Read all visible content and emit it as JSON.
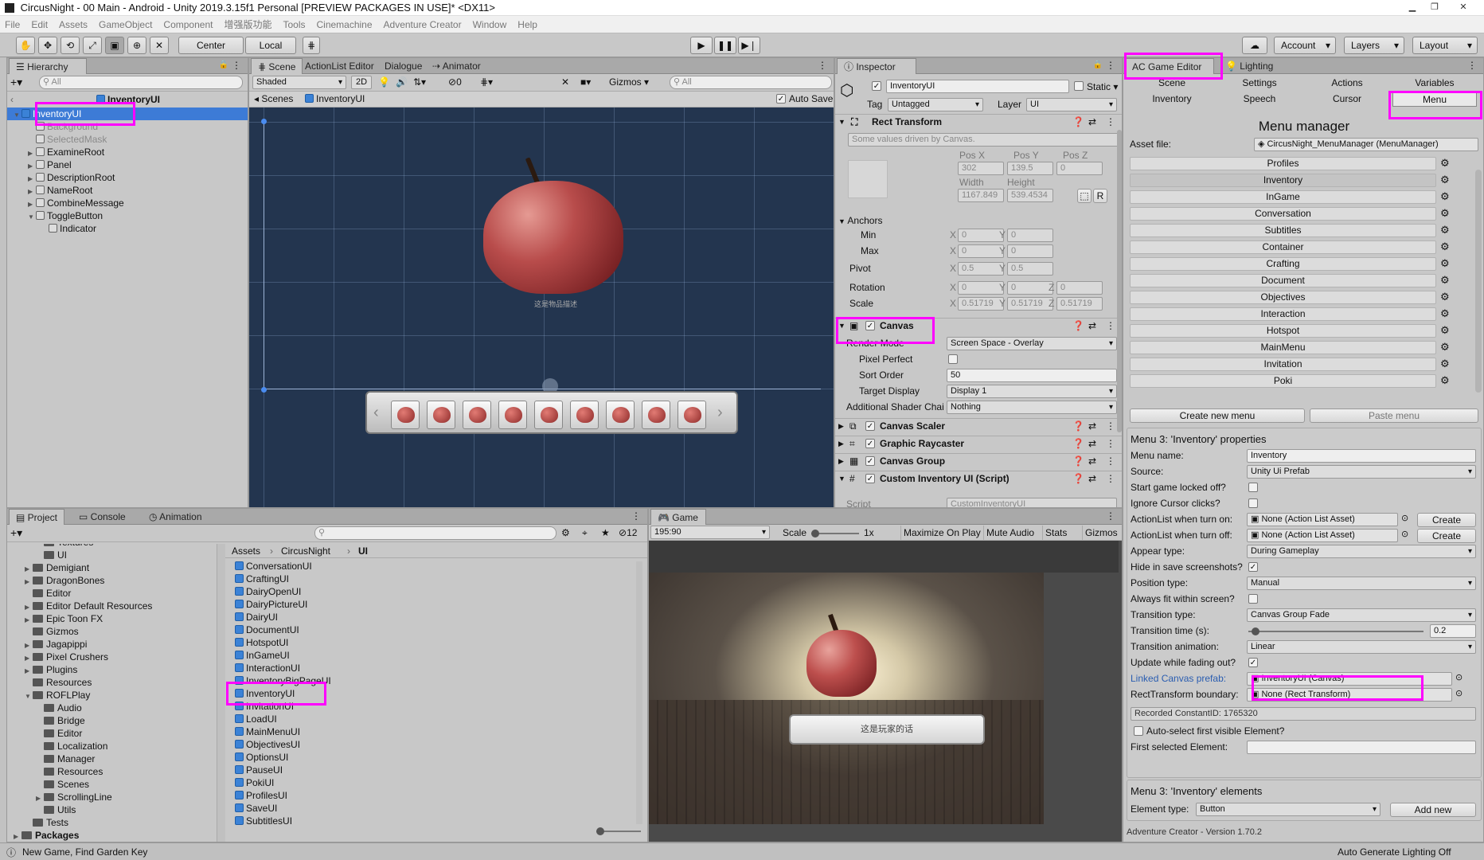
{
  "window": {
    "title": "CircusNight - 00 Main - Android - Unity 2019.3.15f1 Personal [PREVIEW PACKAGES IN USE]* <DX11>"
  },
  "menubar": [
    "File",
    "Edit",
    "Assets",
    "GameObject",
    "Component",
    "增强版功能",
    "Tools",
    "Cinemachine",
    "Adventure Creator",
    "Window",
    "Help"
  ],
  "toolbar": {
    "center_label": "Center",
    "local_label": "Local",
    "account_label": "Account",
    "layers_label": "Layers",
    "layout_label": "Layout"
  },
  "hierarchy": {
    "tab": "Hierarchy",
    "search_placeholder": "All",
    "scene_root": "InventoryUI",
    "items": [
      {
        "label": "InventoryUI",
        "depth": 0,
        "selected": true,
        "disabled": false,
        "arrow": "▼"
      },
      {
        "label": "Background",
        "depth": 1,
        "selected": false,
        "disabled": true,
        "arrow": ""
      },
      {
        "label": "SelectedMask",
        "depth": 1,
        "selected": false,
        "disabled": true,
        "arrow": ""
      },
      {
        "label": "ExamineRoot",
        "depth": 1,
        "selected": false,
        "disabled": false,
        "arrow": "▶"
      },
      {
        "label": "Panel",
        "depth": 1,
        "selected": false,
        "disabled": false,
        "arrow": "▶"
      },
      {
        "label": "DescriptionRoot",
        "depth": 1,
        "selected": false,
        "disabled": false,
        "arrow": "▶"
      },
      {
        "label": "NameRoot",
        "depth": 1,
        "selected": false,
        "disabled": false,
        "arrow": "▶"
      },
      {
        "label": "CombineMessage",
        "depth": 1,
        "selected": false,
        "disabled": false,
        "arrow": "▶"
      },
      {
        "label": "ToggleButton",
        "depth": 1,
        "selected": false,
        "disabled": false,
        "arrow": "▼"
      },
      {
        "label": "Indicator",
        "depth": 2,
        "selected": false,
        "disabled": false,
        "arrow": ""
      }
    ]
  },
  "scene": {
    "tabs": [
      "Scene",
      "ActionList Editor",
      "Dialogue",
      "Animator"
    ],
    "shading": "Shaded",
    "mode_2d": "2D",
    "gizmos_label": "Gizmos",
    "search_placeholder": "All",
    "hidden_count": "0",
    "breadcrumb_scenes": "Scenes",
    "breadcrumb_current": "InventoryUI",
    "auto_save_label": "Auto Save",
    "caption": "这是物品描述"
  },
  "inspector": {
    "tab": "Inspector",
    "object_name": "InventoryUI",
    "static_label": "Static",
    "tag_label": "Tag",
    "tag_value": "Untagged",
    "layer_label": "Layer",
    "layer_value": "UI",
    "rect_transform": {
      "title": "Rect Transform",
      "note": "Some values driven by Canvas.",
      "pos_x_label": "Pos X",
      "pos_y_label": "Pos Y",
      "pos_z_label": "Pos Z",
      "pos_x": "302",
      "pos_y": "139.5",
      "pos_z": "0",
      "width_label": "Width",
      "height_label": "Height",
      "width": "1167.849",
      "height": "539.4534",
      "anchors_label": "Anchors",
      "min_label": "Min",
      "max_label": "Max",
      "min_x": "0",
      "min_y": "0",
      "max_x": "0",
      "max_y": "0",
      "pivot_label": "Pivot",
      "pivot_x": "0.5",
      "pivot_y": "0.5",
      "rotation_label": "Rotation",
      "rot_x": "0",
      "rot_y": "0",
      "rot_z": "0",
      "scale_label": "Scale",
      "scale_x": "0.51719",
      "scale_y": "0.51719",
      "scale_z": "0.51719",
      "x_letter": "X",
      "y_letter": "Y",
      "z_letter": "Z",
      "r_label": "R"
    },
    "canvas": {
      "title": "Canvas",
      "render_mode_label": "Render Mode",
      "render_mode": "Screen Space - Overlay",
      "pixel_perfect_label": "Pixel Perfect",
      "sort_order_label": "Sort Order",
      "sort_order": "50",
      "target_display_label": "Target Display",
      "target_display": "Display 1",
      "shader_channels_label": "Additional Shader Chai",
      "shader_channels": "Nothing"
    },
    "components": [
      "Canvas Scaler",
      "Graphic Raycaster",
      "Canvas Group",
      "Custom Inventory UI (Script)"
    ],
    "script_label": "Script",
    "script_value": "CustomInventoryUI"
  },
  "ac_editor": {
    "tab": "AC Game Editor",
    "lighting_tab": "Lighting",
    "nav_row1": [
      "Scene",
      "Settings",
      "Actions",
      "Variables"
    ],
    "nav_row2": [
      "Inventory",
      "Speech",
      "Cursor",
      "Menu"
    ],
    "title": "Menu manager",
    "asset_file_label": "Asset file:",
    "asset_file_value": "CircusNight_MenuManager (MenuManager)",
    "menus": [
      "Profiles",
      "Inventory",
      "InGame",
      "Conversation",
      "Subtitles",
      "Container",
      "Crafting",
      "Document",
      "Objectives",
      "Interaction",
      "Hotspot",
      "MainMenu",
      "Invitation",
      "Poki"
    ],
    "create_menu": "Create new menu",
    "paste_menu": "Paste menu",
    "props_title": "Menu 3: 'Inventory' properties",
    "props": [
      {
        "label": "Menu name:",
        "value": "Inventory",
        "type": "text"
      },
      {
        "label": "Source:",
        "value": "Unity Ui Prefab",
        "type": "dropdown"
      },
      {
        "label": "Start game locked off?",
        "value": "",
        "type": "check",
        "checked": false
      },
      {
        "label": "Ignore Cursor clicks?",
        "value": "",
        "type": "check",
        "checked": false
      },
      {
        "label": "ActionList when turn on:",
        "value": "None (Action List Asset)",
        "type": "object",
        "button": "Create"
      },
      {
        "label": "ActionList when turn off:",
        "value": "None (Action List Asset)",
        "type": "object",
        "button": "Create"
      },
      {
        "label": "Appear type:",
        "value": "During Gameplay",
        "type": "dropdown"
      },
      {
        "label": "Hide in save screenshots?",
        "value": "",
        "type": "check",
        "checked": true
      },
      {
        "label": "Position type:",
        "value": "Manual",
        "type": "dropdown"
      },
      {
        "label": "Always fit within screen?",
        "value": "",
        "type": "check",
        "checked": false
      },
      {
        "label": "Transition type:",
        "value": "Canvas Group Fade",
        "type": "dropdown"
      },
      {
        "label": "Transition time (s):",
        "value": "0.2",
        "type": "slider",
        "fraction": 0.02
      },
      {
        "label": "Transition animation:",
        "value": "Linear",
        "type": "dropdown"
      },
      {
        "label": "Update while fading out?",
        "value": "",
        "type": "check",
        "checked": true
      },
      {
        "label": "Linked Canvas prefab:",
        "value": "InventoryUI (Canvas)",
        "type": "object",
        "link": true
      },
      {
        "label": "RectTransform boundary:",
        "value": "None (Rect Transform)",
        "type": "object"
      }
    ],
    "constant_id": "Recorded ConstantID: 1765320",
    "auto_select_label": "Auto-select first visible Element?",
    "first_selected_label": "First selected Element:",
    "elements_title": "Menu 3: 'Inventory' elements",
    "element_type_label": "Element type:",
    "element_type_value": "Button",
    "add_new": "Add new",
    "version": "Adventure Creator - Version 1.70.2"
  },
  "project": {
    "tabs": [
      "Project",
      "Console",
      "Animation"
    ],
    "tree": [
      {
        "label": "Textures",
        "depth": 2,
        "arrow": ""
      },
      {
        "label": "UI",
        "depth": 2,
        "arrow": ""
      },
      {
        "label": "Demigiant",
        "depth": 1,
        "arrow": "▶"
      },
      {
        "label": "DragonBones",
        "depth": 1,
        "arrow": "▶"
      },
      {
        "label": "Editor",
        "depth": 1,
        "arrow": ""
      },
      {
        "label": "Editor Default Resources",
        "depth": 1,
        "arrow": "▶"
      },
      {
        "label": "Epic Toon FX",
        "depth": 1,
        "arrow": "▶"
      },
      {
        "label": "Gizmos",
        "depth": 1,
        "arrow": ""
      },
      {
        "label": "Jagapippi",
        "depth": 1,
        "arrow": "▶"
      },
      {
        "label": "Pixel Crushers",
        "depth": 1,
        "arrow": "▶"
      },
      {
        "label": "Plugins",
        "depth": 1,
        "arrow": "▶"
      },
      {
        "label": "Resources",
        "depth": 1,
        "arrow": ""
      },
      {
        "label": "ROFLPlay",
        "depth": 1,
        "arrow": "▼"
      },
      {
        "label": "Audio",
        "depth": 2,
        "arrow": ""
      },
      {
        "label": "Bridge",
        "depth": 2,
        "arrow": ""
      },
      {
        "label": "Editor",
        "depth": 2,
        "arrow": ""
      },
      {
        "label": "Localization",
        "depth": 2,
        "arrow": ""
      },
      {
        "label": "Manager",
        "depth": 2,
        "arrow": ""
      },
      {
        "label": "Resources",
        "depth": 2,
        "arrow": ""
      },
      {
        "label": "Scenes",
        "depth": 2,
        "arrow": ""
      },
      {
        "label": "ScrollingLine",
        "depth": 2,
        "arrow": "▶"
      },
      {
        "label": "Utils",
        "depth": 2,
        "arrow": ""
      },
      {
        "label": "Tests",
        "depth": 1,
        "arrow": ""
      },
      {
        "label": "Packages",
        "depth": 0,
        "arrow": "▶"
      }
    ],
    "breadcrumb": [
      "Assets",
      "CircusNight",
      "UI"
    ],
    "hidden_count": "12",
    "files": [
      "ConversationUI",
      "CraftingUI",
      "DairyOpenUI",
      "DairyPictureUI",
      "DairyUI",
      "DocumentUI",
      "HotspotUI",
      "InGameUI",
      "InteractionUI",
      "InventoryBigPageUI",
      "InventoryUI",
      "InvitationUI",
      "LoadUI",
      "MainMenuUI",
      "ObjectivesUI",
      "OptionsUI",
      "PauseUI",
      "PokiUI",
      "ProfilesUI",
      "SaveUI",
      "SubtitlesUI"
    ]
  },
  "game": {
    "tab": "Game",
    "resolution": "195:90",
    "scale_label": "Scale",
    "scale_value": "1x",
    "toggles": [
      "Maximize On Play",
      "Mute Audio",
      "Stats",
      "Gizmos"
    ],
    "dialog_text": "这是玩家的话"
  },
  "status": {
    "left": "New Game, Find Garden Key",
    "right": "Auto Generate Lighting Off"
  },
  "colors": {
    "highlight": "#ff00ff",
    "selection": "#3d7bd6",
    "scene_bg": "#23354f",
    "link": "#2a5db0"
  }
}
